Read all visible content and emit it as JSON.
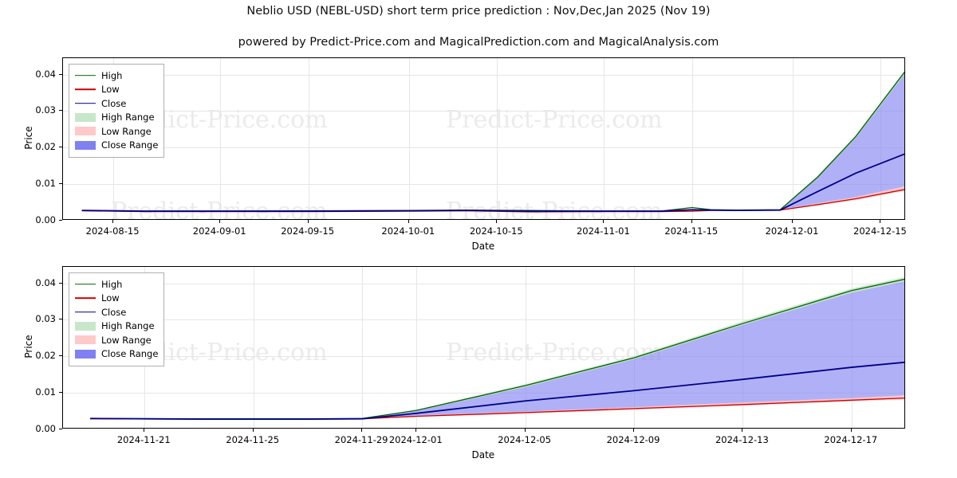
{
  "header": {
    "title": "Neblio USD (NEBL-USD) short term price prediction : Nov,Dec,Jan 2025 (Nov 19)",
    "subtitle": "powered by Predict-Price.com and MagicalPrediction.com and MagicalAnalysis.com"
  },
  "watermark": {
    "text": "Predict-Price.com"
  },
  "legend": {
    "items": [
      {
        "label": "High",
        "color": "#006400",
        "type": "line"
      },
      {
        "label": "Low",
        "color": "#cc0000",
        "type": "line"
      },
      {
        "label": "Close",
        "color": "#00008b",
        "type": "line"
      },
      {
        "label": "High Range",
        "color": "#c8e6c9",
        "type": "patch"
      },
      {
        "label": "Low Range",
        "color": "#ffc9c9",
        "type": "patch"
      },
      {
        "label": "Close Range",
        "color": "#8080f0",
        "type": "patch"
      }
    ]
  },
  "chart_data": [
    {
      "type": "line",
      "id": "top-panel",
      "title": "",
      "xlabel": "Date",
      "ylabel": "Price",
      "xlim": [
        "2024-08-07",
        "2024-12-19"
      ],
      "ylim": [
        0.0,
        0.0445
      ],
      "yticks": [
        0.0,
        0.01,
        0.02,
        0.03,
        0.04
      ],
      "ytick_labels": [
        "0.00",
        "0.01",
        "0.02",
        "0.03",
        "0.04"
      ],
      "xticks": [
        "2024-08-15",
        "2024-09-01",
        "2024-09-15",
        "2024-10-01",
        "2024-10-15",
        "2024-11-01",
        "2024-11-15",
        "2024-12-01",
        "2024-12-15"
      ],
      "grid": true,
      "series": [
        {
          "name": "High",
          "color": "#006400",
          "x": [
            "2024-08-10",
            "2024-08-20",
            "2024-09-01",
            "2024-09-15",
            "2024-10-01",
            "2024-10-10",
            "2024-10-20",
            "2024-11-01",
            "2024-11-10",
            "2024-11-15",
            "2024-11-18",
            "2024-11-22",
            "2024-11-29",
            "2024-12-05",
            "2024-12-11",
            "2024-12-19"
          ],
          "values": [
            0.0028,
            0.0026,
            0.0026,
            0.0027,
            0.0028,
            0.0029,
            0.0028,
            0.0026,
            0.0026,
            0.0036,
            0.003,
            0.0029,
            0.003,
            0.012,
            0.023,
            0.0412
          ]
        },
        {
          "name": "Low",
          "color": "#cc0000",
          "x": [
            "2024-08-10",
            "2024-08-20",
            "2024-09-01",
            "2024-09-15",
            "2024-10-01",
            "2024-10-10",
            "2024-10-20",
            "2024-11-01",
            "2024-11-10",
            "2024-11-15",
            "2024-11-18",
            "2024-11-22",
            "2024-11-29",
            "2024-12-05",
            "2024-12-11",
            "2024-12-19"
          ],
          "values": [
            0.0027,
            0.0025,
            0.0025,
            0.0025,
            0.0026,
            0.0027,
            0.0024,
            0.0025,
            0.0025,
            0.0026,
            0.0028,
            0.0028,
            0.0029,
            0.0044,
            0.006,
            0.0086
          ]
        },
        {
          "name": "Close",
          "color": "#00008b",
          "x": [
            "2024-08-10",
            "2024-08-20",
            "2024-09-01",
            "2024-09-15",
            "2024-10-01",
            "2024-10-10",
            "2024-10-20",
            "2024-11-01",
            "2024-11-10",
            "2024-11-15",
            "2024-11-18",
            "2024-11-22",
            "2024-11-29",
            "2024-12-05",
            "2024-12-11",
            "2024-12-19"
          ],
          "values": [
            0.0028,
            0.0026,
            0.0026,
            0.0026,
            0.0027,
            0.0028,
            0.0026,
            0.0026,
            0.0026,
            0.003,
            0.0029,
            0.0028,
            0.0029,
            0.008,
            0.013,
            0.0184
          ]
        }
      ],
      "bands": [
        {
          "name": "Close Range",
          "color": "#8080f0",
          "x": [
            "2024-11-29",
            "2024-12-05",
            "2024-12-11",
            "2024-12-19"
          ],
          "upper": [
            0.003,
            0.012,
            0.0228,
            0.041
          ],
          "lower": [
            0.0029,
            0.0046,
            0.0062,
            0.009
          ]
        },
        {
          "name": "High Range",
          "color": "#c8e6c9",
          "x": [
            "2024-11-29",
            "2024-12-05",
            "2024-12-11",
            "2024-12-19"
          ],
          "upper": [
            0.0031,
            0.0124,
            0.0234,
            0.0416
          ],
          "lower": [
            0.003,
            0.0118,
            0.0226,
            0.0406
          ]
        },
        {
          "name": "Low Range",
          "color": "#ffc9c9",
          "x": [
            "2024-11-29",
            "2024-12-05",
            "2024-12-11",
            "2024-12-19"
          ],
          "upper": [
            0.003,
            0.0048,
            0.0065,
            0.0095
          ],
          "lower": [
            0.0029,
            0.0042,
            0.0056,
            0.0082
          ]
        }
      ]
    },
    {
      "type": "line",
      "id": "bottom-panel",
      "title": "",
      "xlabel": "Date",
      "ylabel": "Price",
      "xlim": [
        "2024-11-18",
        "2024-12-19"
      ],
      "ylim": [
        0.0,
        0.0445
      ],
      "yticks": [
        0.0,
        0.01,
        0.02,
        0.03,
        0.04
      ],
      "ytick_labels": [
        "0.00",
        "0.01",
        "0.02",
        "0.03",
        "0.04"
      ],
      "xticks": [
        "2024-11-21",
        "2024-11-25",
        "2024-11-29",
        "2024-12-01",
        "2024-12-05",
        "2024-12-09",
        "2024-12-13",
        "2024-12-17"
      ],
      "grid": true,
      "series": [
        {
          "name": "High",
          "color": "#006400",
          "x": [
            "2024-11-19",
            "2024-11-23",
            "2024-11-27",
            "2024-11-29",
            "2024-12-01",
            "2024-12-05",
            "2024-12-09",
            "2024-12-13",
            "2024-12-17",
            "2024-12-19"
          ],
          "values": [
            0.003,
            0.0029,
            0.0029,
            0.003,
            0.0052,
            0.012,
            0.0196,
            0.029,
            0.038,
            0.0412
          ]
        },
        {
          "name": "Low",
          "color": "#cc0000",
          "x": [
            "2024-11-19",
            "2024-11-23",
            "2024-11-27",
            "2024-11-29",
            "2024-12-01",
            "2024-12-05",
            "2024-12-09",
            "2024-12-13",
            "2024-12-17",
            "2024-12-19"
          ],
          "values": [
            0.0029,
            0.0028,
            0.0028,
            0.0029,
            0.0036,
            0.0046,
            0.0057,
            0.0068,
            0.008,
            0.0086
          ]
        },
        {
          "name": "Close",
          "color": "#00008b",
          "x": [
            "2024-11-19",
            "2024-11-23",
            "2024-11-27",
            "2024-11-29",
            "2024-12-01",
            "2024-12-05",
            "2024-12-09",
            "2024-12-13",
            "2024-12-17",
            "2024-12-19"
          ],
          "values": [
            0.003,
            0.0028,
            0.0028,
            0.0029,
            0.0044,
            0.0078,
            0.0106,
            0.0137,
            0.017,
            0.0184
          ]
        }
      ],
      "bands": [
        {
          "name": "Close Range",
          "color": "#8080f0",
          "x": [
            "2024-11-29",
            "2024-12-01",
            "2024-12-05",
            "2024-12-09",
            "2024-12-13",
            "2024-12-17",
            "2024-12-19"
          ],
          "upper": [
            0.003,
            0.0052,
            0.0118,
            0.0194,
            0.0288,
            0.0378,
            0.041
          ],
          "lower": [
            0.0029,
            0.0036,
            0.0046,
            0.0058,
            0.007,
            0.0082,
            0.009
          ]
        },
        {
          "name": "High Range",
          "color": "#c8e6c9",
          "x": [
            "2024-11-29",
            "2024-12-01",
            "2024-12-05",
            "2024-12-09",
            "2024-12-13",
            "2024-12-17",
            "2024-12-19"
          ],
          "upper": [
            0.0031,
            0.0054,
            0.0124,
            0.02,
            0.0296,
            0.0386,
            0.0418
          ],
          "lower": [
            0.003,
            0.005,
            0.0116,
            0.0192,
            0.0286,
            0.0374,
            0.0406
          ]
        },
        {
          "name": "Low Range",
          "color": "#ffc9c9",
          "x": [
            "2024-11-29",
            "2024-12-01",
            "2024-12-05",
            "2024-12-09",
            "2024-12-13",
            "2024-12-17",
            "2024-12-19"
          ],
          "upper": [
            0.003,
            0.0038,
            0.0049,
            0.0061,
            0.0074,
            0.0086,
            0.0094
          ],
          "lower": [
            0.0029,
            0.0034,
            0.0043,
            0.0054,
            0.0065,
            0.0077,
            0.0082
          ]
        }
      ]
    }
  ]
}
